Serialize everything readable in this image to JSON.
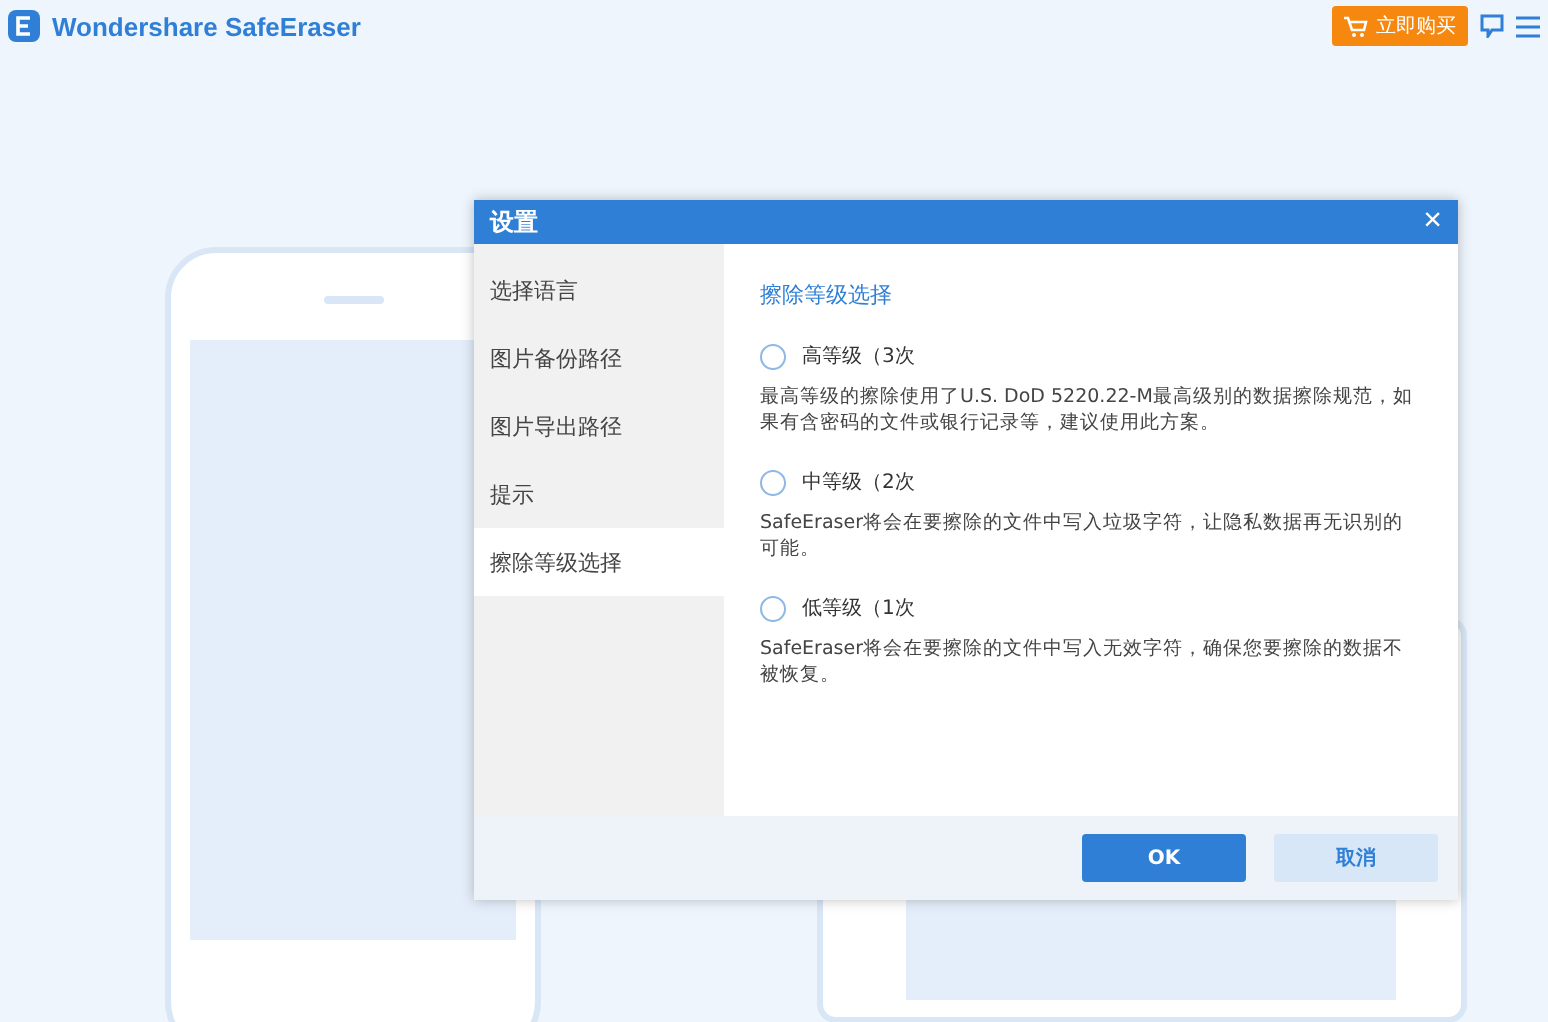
{
  "app": {
    "title": "Wondershare SafeEraser",
    "buy_button": "立即购买"
  },
  "dialog": {
    "title": "设置",
    "close": "×",
    "sidebar": [
      {
        "label": "选择语言",
        "selected": false
      },
      {
        "label": "图片备份路径",
        "selected": false
      },
      {
        "label": "图片导出路径",
        "selected": false
      },
      {
        "label": "提示",
        "selected": false
      },
      {
        "label": "擦除等级选择",
        "selected": true
      }
    ],
    "section_title": "擦除等级选择",
    "options": [
      {
        "label": "高等级（3次",
        "selected": false,
        "description": "最高等级的擦除使用了U.S. DoD 5220.22-M最高级别的数据擦除规范，如果有含密码的文件或银行记录等，建议使用此方案。"
      },
      {
        "label": "中等级（2次",
        "selected": false,
        "description": "SafeEraser将会在要擦除的文件中写入垃圾字符，让隐私数据再无识别的可能。"
      },
      {
        "label": "低等级（1次",
        "selected": false,
        "description": "SafeEraser将会在要擦除的文件中写入无效字符，确保您要擦除的数据不被恢复。"
      }
    ],
    "buttons": [
      {
        "label": "OK",
        "kind": "primary"
      },
      {
        "label": "取消",
        "kind": "secondary"
      }
    ]
  }
}
